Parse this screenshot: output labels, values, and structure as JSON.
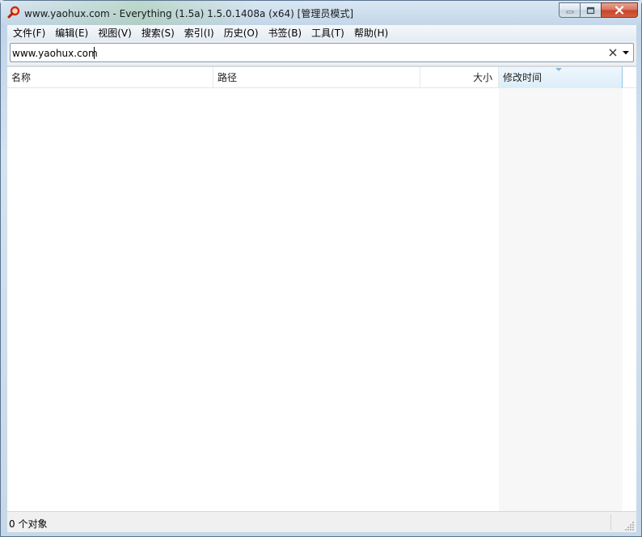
{
  "window": {
    "title": "www.yaohux.com - Everything (1.5a) 1.5.0.1408a (x64) [管理员模式]",
    "app_icon": "magnifier-icon"
  },
  "controls": {
    "minimize_icon": "minimize-icon",
    "maximize_icon": "restore-icon",
    "close_icon": "close-icon"
  },
  "menu": [
    {
      "label": "文件(F)"
    },
    {
      "label": "编辑(E)"
    },
    {
      "label": "视图(V)"
    },
    {
      "label": "搜索(S)"
    },
    {
      "label": "索引(I)"
    },
    {
      "label": "历史(O)"
    },
    {
      "label": "书签(B)"
    },
    {
      "label": "工具(T)"
    },
    {
      "label": "帮助(H)"
    }
  ],
  "search": {
    "value": "www.yaohux.com",
    "clear_icon": "clear-icon",
    "dropdown_icon": "chevron-down-icon"
  },
  "columns": {
    "name": "名称",
    "path": "路径",
    "size": "大小",
    "modified": "修改时间"
  },
  "sort": {
    "column": "modified",
    "direction": "ascending"
  },
  "results": [],
  "status": {
    "text": "0 个对象"
  },
  "colors": {
    "accent": "#96c6e8",
    "sorted_header": "#dcedf8",
    "frame": "#c6d8e8"
  }
}
